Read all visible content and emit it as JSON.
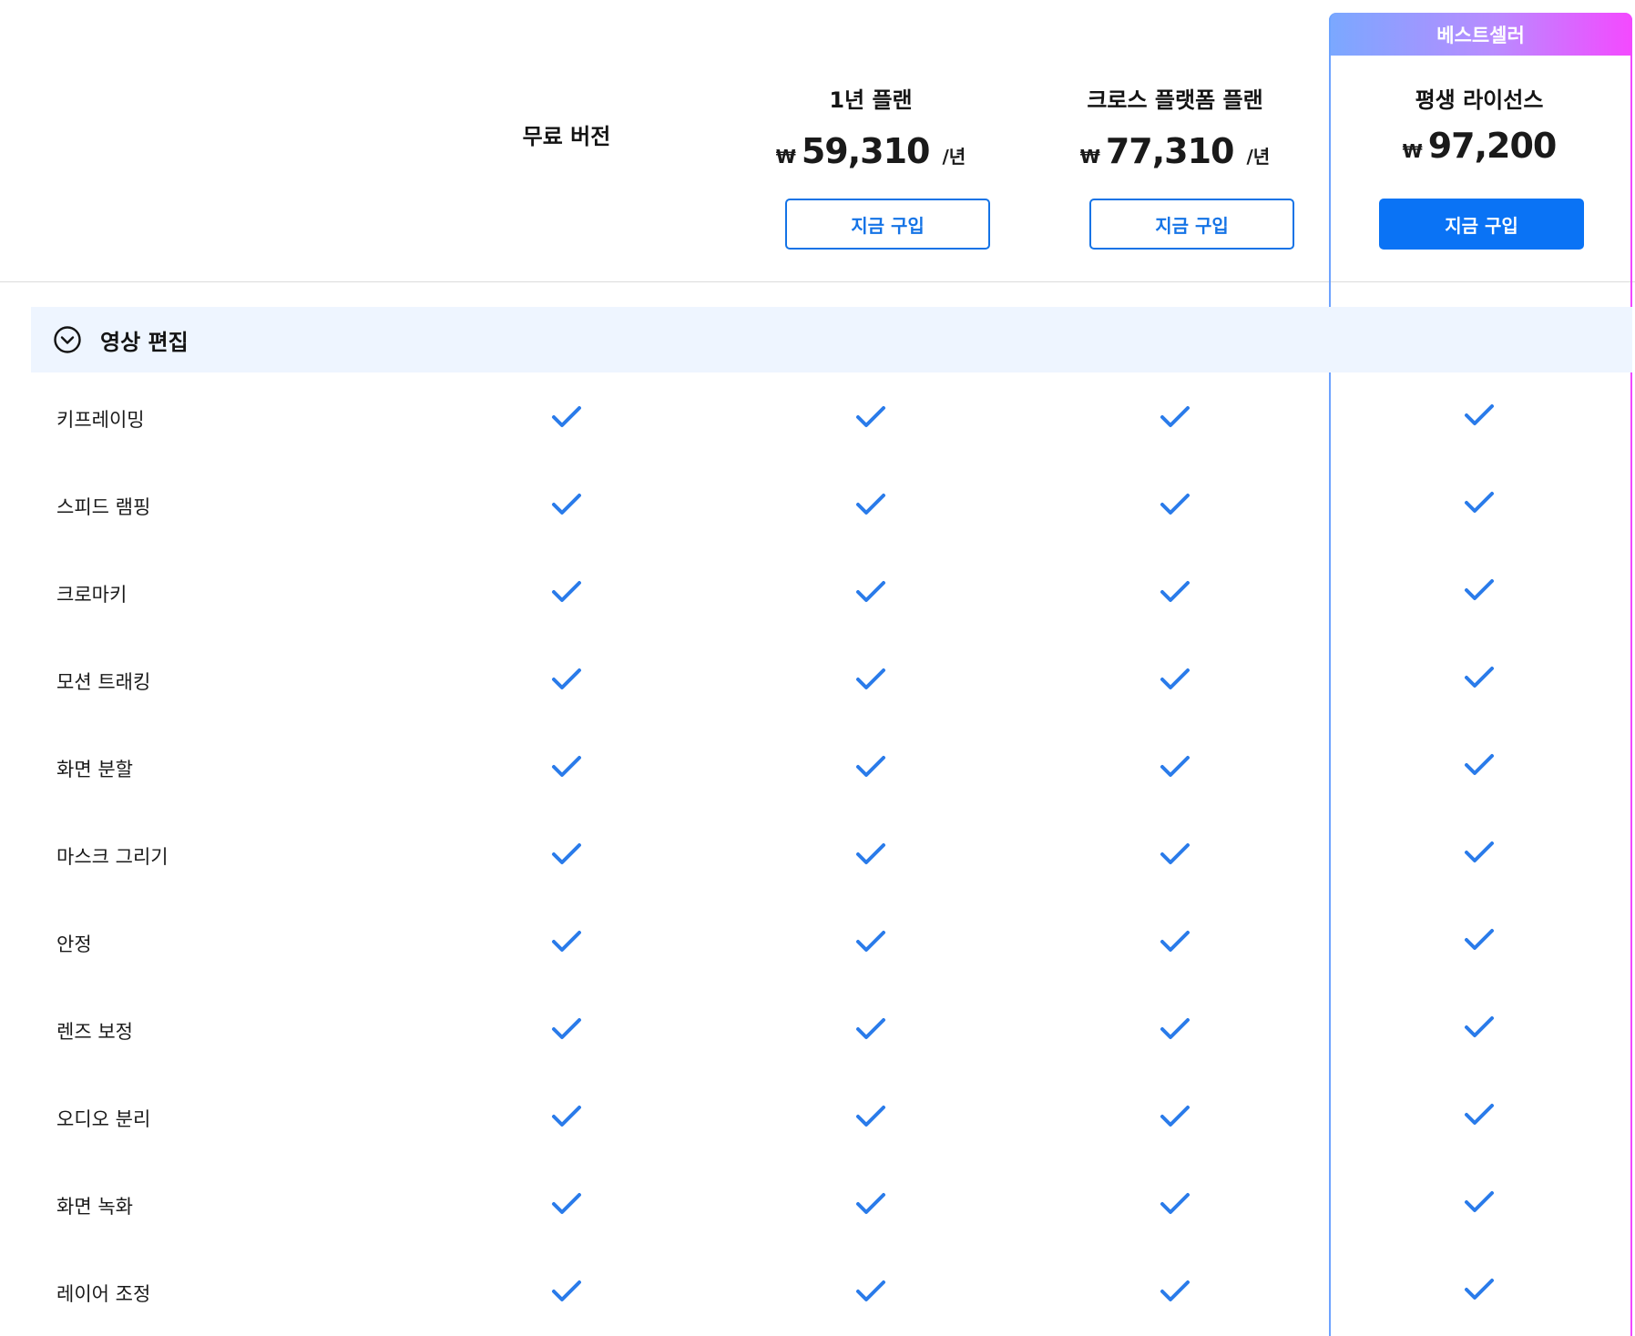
{
  "badge": {
    "bestseller": "베스트셀러"
  },
  "plans": {
    "free": {
      "name": "무료 버전"
    },
    "year": {
      "name": "1년 플랜",
      "currency": "₩",
      "price": "59,310",
      "period": "/년",
      "cta": "지금 구입"
    },
    "cross": {
      "name": "크로스 플랫폼 플랜",
      "currency": "₩",
      "price": "77,310",
      "period": "/년",
      "cta": "지금 구입"
    },
    "life": {
      "name": "평생 라이선스",
      "currency": "₩",
      "price": "97,200",
      "cta": "지금 구입"
    }
  },
  "section": {
    "title": "영상 편집",
    "toggle_icon": "chevron-down-circle-icon"
  },
  "features": [
    "키프레이밍",
    "스피드 램핑",
    "크로마키",
    "모션 트래킹",
    "화면 분할",
    "마스크 그리기",
    "안정",
    "렌즈 보정",
    "오디오 분리",
    "화면 녹화",
    "레이어 조정"
  ],
  "colors": {
    "accent": "#1473e6",
    "check": "#2a7bea",
    "section_bg": "#eef5ff",
    "gradient_start": "#7aa8ff",
    "gradient_end": "#f449ff"
  }
}
